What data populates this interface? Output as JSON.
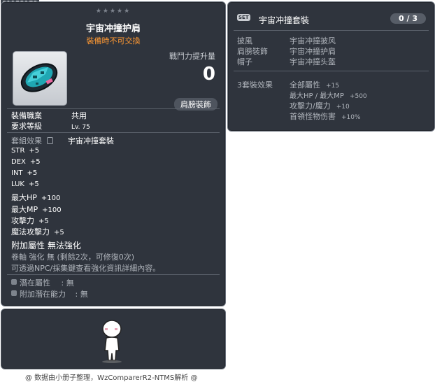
{
  "item_id": "01152172",
  "item": {
    "stars": "★★★★★",
    "name": "宇宙冲撞护肩",
    "untradeable": "裝備時不可交換",
    "power_label": "戰鬥力提升量",
    "power_value": "0",
    "category": "肩膀裝飾",
    "job_label": "裝備職業",
    "job_value": "共用",
    "level_label": "要求等級",
    "level_value": "Lv. 75",
    "set_label": "套組效果",
    "set_value": "宇宙冲撞套裝",
    "stats": [
      {
        "name": "STR",
        "value": "+5"
      },
      {
        "name": "DEX",
        "value": "+5"
      },
      {
        "name": "INT",
        "value": "+5"
      },
      {
        "name": "LUK",
        "value": "+5"
      },
      {
        "name": "最大HP",
        "value": "+100"
      },
      {
        "name": "最大MP",
        "value": "+100"
      },
      {
        "name": "攻擊力",
        "value": "+5"
      },
      {
        "name": "魔法攻擊力",
        "value": "+5"
      }
    ],
    "extra_attr_label": "附加屬性",
    "extra_attr_value": "無法強化",
    "scroll_line": "卷軸 強化 無 (剩餘2次，可修復0次)",
    "npc_line": "可透過NPC/採集鍵查看強化資訊詳細內容。",
    "potential_label": "潛在屬性",
    "potential_value": ": 無",
    "extra_potential_label": "附加潛在能力",
    "extra_potential_value": ": 無"
  },
  "set": {
    "badge": "SET",
    "name": "宇宙冲撞套裝",
    "count": "0 / 3",
    "parts": [
      {
        "slot": "披風",
        "name": "宇宙冲撞披风"
      },
      {
        "slot": "肩膀裝飾",
        "name": "宇宙冲撞护肩"
      },
      {
        "slot": "帽子",
        "name": "宇宙冲撞头盔"
      }
    ],
    "bonus_label": "3套裝效果",
    "bonuses": [
      {
        "name": "全部屬性",
        "value": "+15"
      },
      {
        "name": "最大HP / 最大MP",
        "value": "+500"
      },
      {
        "name": "攻擊力/魔力",
        "value": "+10"
      },
      {
        "name": "首領怪物伤害",
        "value": "+10%"
      }
    ]
  },
  "credit": "@ 数据由小册子整理，WzComparerR2-NTMS解析 @",
  "colors": {
    "panel_bg": "#2f343d",
    "untradeable": "#ff9933",
    "secondary_text": "#b0b5bc"
  },
  "icons": {
    "item": "shoulder-pad-icon",
    "potential": "potential-square-icon",
    "lock": "lock-icon"
  }
}
